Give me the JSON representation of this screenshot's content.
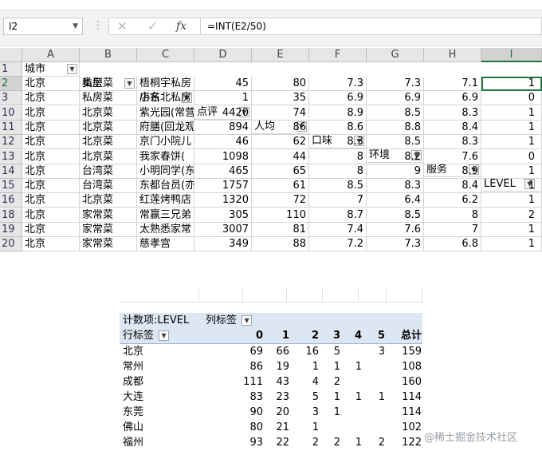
{
  "formula_bar": {
    "name_box": "I2",
    "cancel_icon": "✕",
    "enter_icon": "✓",
    "fx_label": "fx",
    "formula": "=INT(E2/50)"
  },
  "sheet": {
    "columns": [
      "A",
      "B",
      "C",
      "D",
      "E",
      "F",
      "G",
      "H",
      "I"
    ],
    "header_row_number": "1",
    "headers": [
      "城市",
      "类型",
      "店名",
      "点评",
      "人均",
      "口味",
      "环境",
      "服务",
      "LEVEL"
    ],
    "rows": [
      {
        "num": "2",
        "city": "北京",
        "type": "私房菜",
        "name": "梧桐宇私房",
        "reviews": "45",
        "avg": "80",
        "taste": "7.3",
        "env": "7.3",
        "service": "7.1",
        "level": "1"
      },
      {
        "num": "3",
        "city": "北京",
        "type": "私房菜",
        "name": "小东北私房",
        "reviews": "1",
        "avg": "35",
        "taste": "6.9",
        "env": "6.9",
        "service": "6.9",
        "level": "0"
      },
      {
        "num": "10",
        "city": "北京",
        "type": "北京菜",
        "name": "紫光园(常营",
        "reviews": "4420",
        "avg": "74",
        "taste": "8.9",
        "env": "8.5",
        "service": "8.3",
        "level": "1"
      },
      {
        "num": "11",
        "city": "北京",
        "type": "北京菜",
        "name": "府膳(回龙观",
        "reviews": "894",
        "avg": "86",
        "taste": "8.6",
        "env": "8.8",
        "service": "8.4",
        "level": "1"
      },
      {
        "num": "12",
        "city": "北京",
        "type": "北京菜",
        "name": "京门小院儿",
        "reviews": "46",
        "avg": "62",
        "taste": "8.3",
        "env": "8.5",
        "service": "8.3",
        "level": "1"
      },
      {
        "num": "13",
        "city": "北京",
        "type": "北京菜",
        "name": "我家春饼(",
        "reviews": "1098",
        "avg": "44",
        "taste": "8",
        "env": "8.2",
        "service": "7.6",
        "level": "0"
      },
      {
        "num": "14",
        "city": "北京",
        "type": "台湾菜",
        "name": "小明同学(东",
        "reviews": "465",
        "avg": "65",
        "taste": "8",
        "env": "9",
        "service": "8.9",
        "level": "1"
      },
      {
        "num": "15",
        "city": "北京",
        "type": "台湾菜",
        "name": "东都台员(亦",
        "reviews": "1757",
        "avg": "61",
        "taste": "8.5",
        "env": "8.3",
        "service": "8.4",
        "level": "1"
      },
      {
        "num": "16",
        "city": "北京",
        "type": "北京菜",
        "name": "红莲烤鸭店",
        "reviews": "1320",
        "avg": "72",
        "taste": "7",
        "env": "6.4",
        "service": "6.2",
        "level": "1"
      },
      {
        "num": "18",
        "city": "北京",
        "type": "家常菜",
        "name": "常赢三兄弟",
        "reviews": "305",
        "avg": "110",
        "taste": "8.7",
        "env": "8.5",
        "service": "8",
        "level": "2"
      },
      {
        "num": "19",
        "city": "北京",
        "type": "家常菜",
        "name": "太熟悉家常",
        "reviews": "3007",
        "avg": "81",
        "taste": "7.4",
        "env": "7.6",
        "service": "7",
        "level": "1"
      },
      {
        "num": "20",
        "city": "北京",
        "type": "家常菜",
        "name": "慈孝宫",
        "reviews": "349",
        "avg": "88",
        "taste": "7.2",
        "env": "7.3",
        "service": "6.8",
        "level": "1"
      }
    ]
  },
  "pivot": {
    "title": "计数项:LEVEL",
    "col_label": "列标签",
    "row_label": "行标签",
    "col_keys": [
      "0",
      "1",
      "2",
      "3",
      "4",
      "5"
    ],
    "total_label": "总计",
    "rows": [
      {
        "city": "北京",
        "c0": "69",
        "c1": "66",
        "c2": "16",
        "c3": "5",
        "c4": "",
        "c5": "3",
        "total": "159"
      },
      {
        "city": "常州",
        "c0": "86",
        "c1": "19",
        "c2": "1",
        "c3": "1",
        "c4": "1",
        "c5": "",
        "total": "108"
      },
      {
        "city": "成都",
        "c0": "111",
        "c1": "43",
        "c2": "4",
        "c3": "2",
        "c4": "",
        "c5": "",
        "total": "160"
      },
      {
        "city": "大连",
        "c0": "83",
        "c1": "23",
        "c2": "5",
        "c3": "1",
        "c4": "1",
        "c5": "1",
        "total": "114"
      },
      {
        "city": "东莞",
        "c0": "90",
        "c1": "20",
        "c2": "3",
        "c3": "1",
        "c4": "",
        "c5": "",
        "total": "114"
      },
      {
        "city": "佛山",
        "c0": "80",
        "c1": "21",
        "c2": "1",
        "c3": "",
        "c4": "",
        "c5": "",
        "total": "102"
      },
      {
        "city": "福州",
        "c0": "93",
        "c1": "22",
        "c2": "2",
        "c3": "2",
        "c4": "1",
        "c5": "2",
        "total": "122"
      }
    ]
  },
  "watermark": "@稀土掘金技术社区"
}
